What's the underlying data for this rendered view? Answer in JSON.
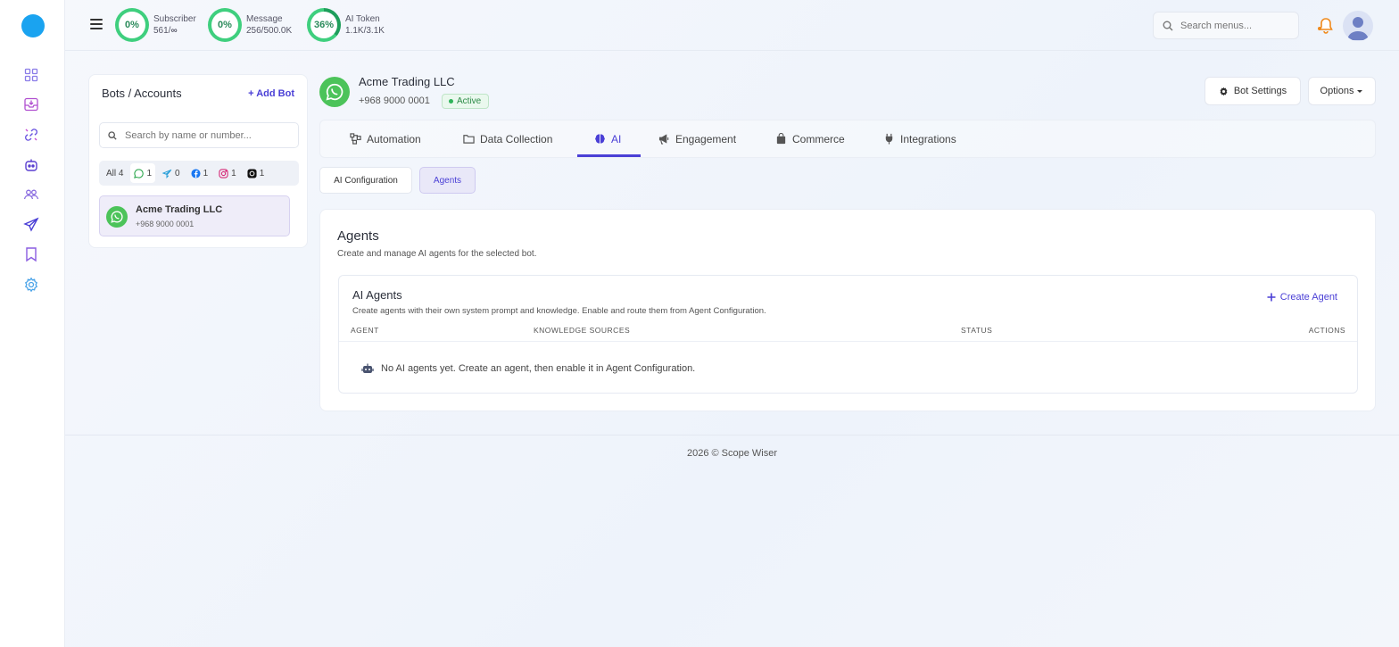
{
  "topbar": {
    "stats": [
      {
        "percent": "0%",
        "label": "Subscriber",
        "value": "561/",
        "value_suffix": "∞",
        "fill": 0
      },
      {
        "percent": "0%",
        "label": "Message",
        "value": "256/500.0K",
        "fill": 0
      },
      {
        "percent": "36%",
        "label": "AI Token",
        "value": "1.1K/3.1K",
        "fill": 0.36
      }
    ],
    "search_placeholder": "Search menus..."
  },
  "sidebar": {
    "icons": [
      "dashboard-icon",
      "inbox-icon",
      "link-icon",
      "bot-icon",
      "users-icon",
      "send-icon",
      "bookmark-icon",
      "settings-icon"
    ]
  },
  "bots": {
    "title": "Bots / Accounts",
    "add_label": "Add Bot",
    "search_placeholder": "Search by name or number...",
    "filters": [
      {
        "label": "All",
        "count": "4",
        "icon": ""
      },
      {
        "label": "",
        "count": "1",
        "icon": "whatsapp-icon"
      },
      {
        "label": "",
        "count": "0",
        "icon": "telegram-icon"
      },
      {
        "label": "",
        "count": "1",
        "icon": "facebook-icon"
      },
      {
        "label": "",
        "count": "1",
        "icon": "instagram-icon"
      },
      {
        "label": "",
        "count": "1",
        "icon": "threads-icon"
      }
    ],
    "items": [
      {
        "name": "Acme Trading LLC",
        "number": "+968 9000 0001"
      }
    ]
  },
  "bot_header": {
    "name": "Acme Trading LLC",
    "number": "+968 9000 0001",
    "status": "Active",
    "settings_label": "Bot Settings",
    "options_label": "Options"
  },
  "tabs": [
    {
      "label": "Automation",
      "icon": "automation-icon"
    },
    {
      "label": "Data Collection",
      "icon": "folder-icon"
    },
    {
      "label": "AI",
      "icon": "brain-icon"
    },
    {
      "label": "Engagement",
      "icon": "megaphone-icon"
    },
    {
      "label": "Commerce",
      "icon": "bag-icon"
    },
    {
      "label": "Integrations",
      "icon": "plug-icon"
    }
  ],
  "subtabs": [
    {
      "label": "AI Configuration"
    },
    {
      "label": "Agents"
    }
  ],
  "agents": {
    "title": "Agents",
    "subtitle": "Create and manage AI agents for the selected bot.",
    "inner_title": "AI Agents",
    "inner_subtitle": "Create agents with their own system prompt and knowledge. Enable and route them from Agent Configuration.",
    "create_label": "Create Agent",
    "columns": [
      "AGENT",
      "KNOWLEDGE SOURCES",
      "STATUS",
      "ACTIONS"
    ],
    "empty_text": "No AI agents yet. Create an agent, then enable it in Agent Configuration."
  },
  "footer": {
    "text": "2026 © Scope Wiser"
  },
  "colors": {
    "accent": "#4a3fd6",
    "ring": "#3fcf7e",
    "whatsapp": "#4cc35a"
  }
}
